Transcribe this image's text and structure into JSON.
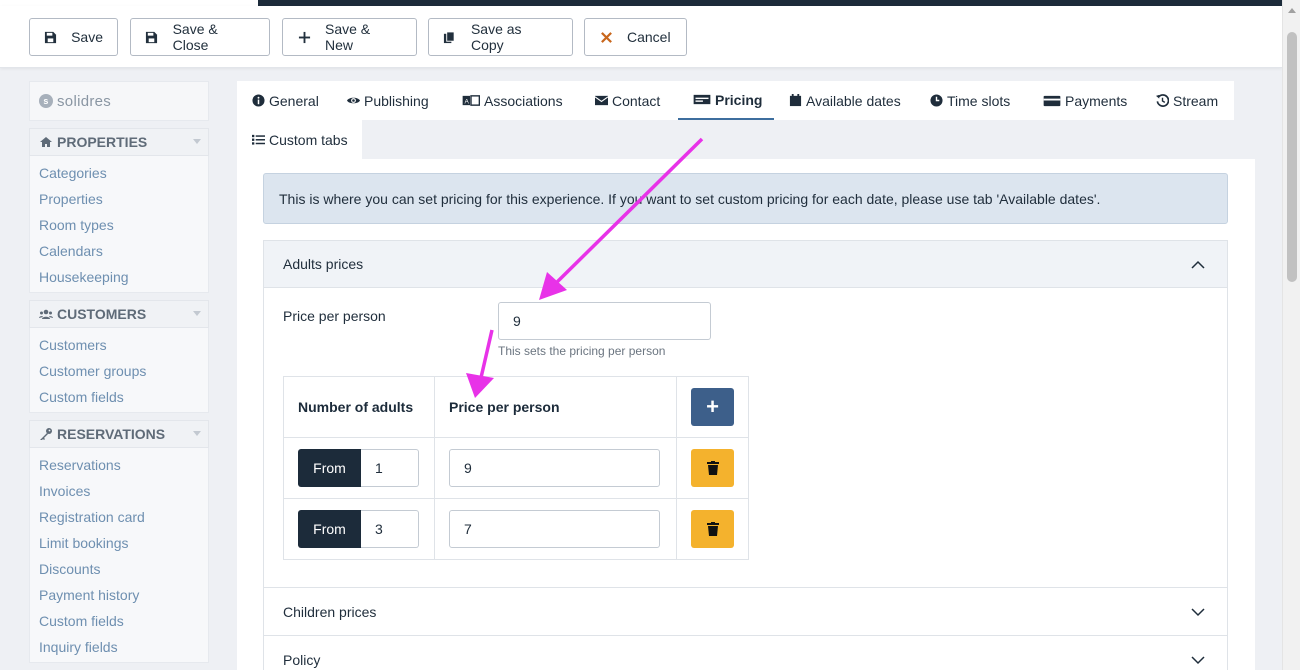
{
  "toolbar": {
    "save": "Save",
    "save_close": "Save & Close",
    "save_new": "Save & New",
    "save_copy": "Save as Copy",
    "cancel": "Cancel"
  },
  "sidebar": {
    "logo": "solidres",
    "sections": [
      {
        "title": "PROPERTIES",
        "icon": "home-icon",
        "items": [
          "Categories",
          "Properties",
          "Room types",
          "Calendars",
          "Housekeeping"
        ]
      },
      {
        "title": "CUSTOMERS",
        "icon": "users-icon",
        "items": [
          "Customers",
          "Customer groups",
          "Custom fields"
        ]
      },
      {
        "title": "RESERVATIONS",
        "icon": "key-icon",
        "items": [
          "Reservations",
          "Invoices",
          "Registration card",
          "Limit bookings",
          "Discounts",
          "Payment history",
          "Custom fields",
          "Inquiry fields"
        ]
      }
    ]
  },
  "tabs": {
    "general": "General",
    "publishing": "Publishing",
    "associations": "Associations",
    "contact": "Contact",
    "pricing": "Pricing",
    "available_dates": "Available dates",
    "time_slots": "Time slots",
    "payments": "Payments",
    "stream": "Stream",
    "custom_tabs": "Custom tabs",
    "active": "Pricing"
  },
  "info": {
    "message": "This is where you can set pricing for this experience. If you want to set custom pricing for each date, please use tab 'Available dates'."
  },
  "adults": {
    "title": "Adults prices",
    "price_label": "Price per person",
    "price_value": "9",
    "help": "This sets the pricing per person",
    "col_number": "Number of adults",
    "col_price": "Price per person",
    "add_label": "+",
    "rows": [
      {
        "from_label": "From",
        "from_value": "1",
        "price": "9"
      },
      {
        "from_label": "From",
        "from_value": "3",
        "price": "7"
      }
    ]
  },
  "children": {
    "title": "Children prices"
  },
  "policy": {
    "title": "Policy"
  },
  "colors": {
    "dark": "#1c2b3a",
    "accent_blue": "#3d5f8a",
    "delete_yellow": "#f4b22d",
    "arrow_magenta": "#e832e8",
    "info_bg": "#dce5ef",
    "link_blue": "#6e8fb0"
  }
}
